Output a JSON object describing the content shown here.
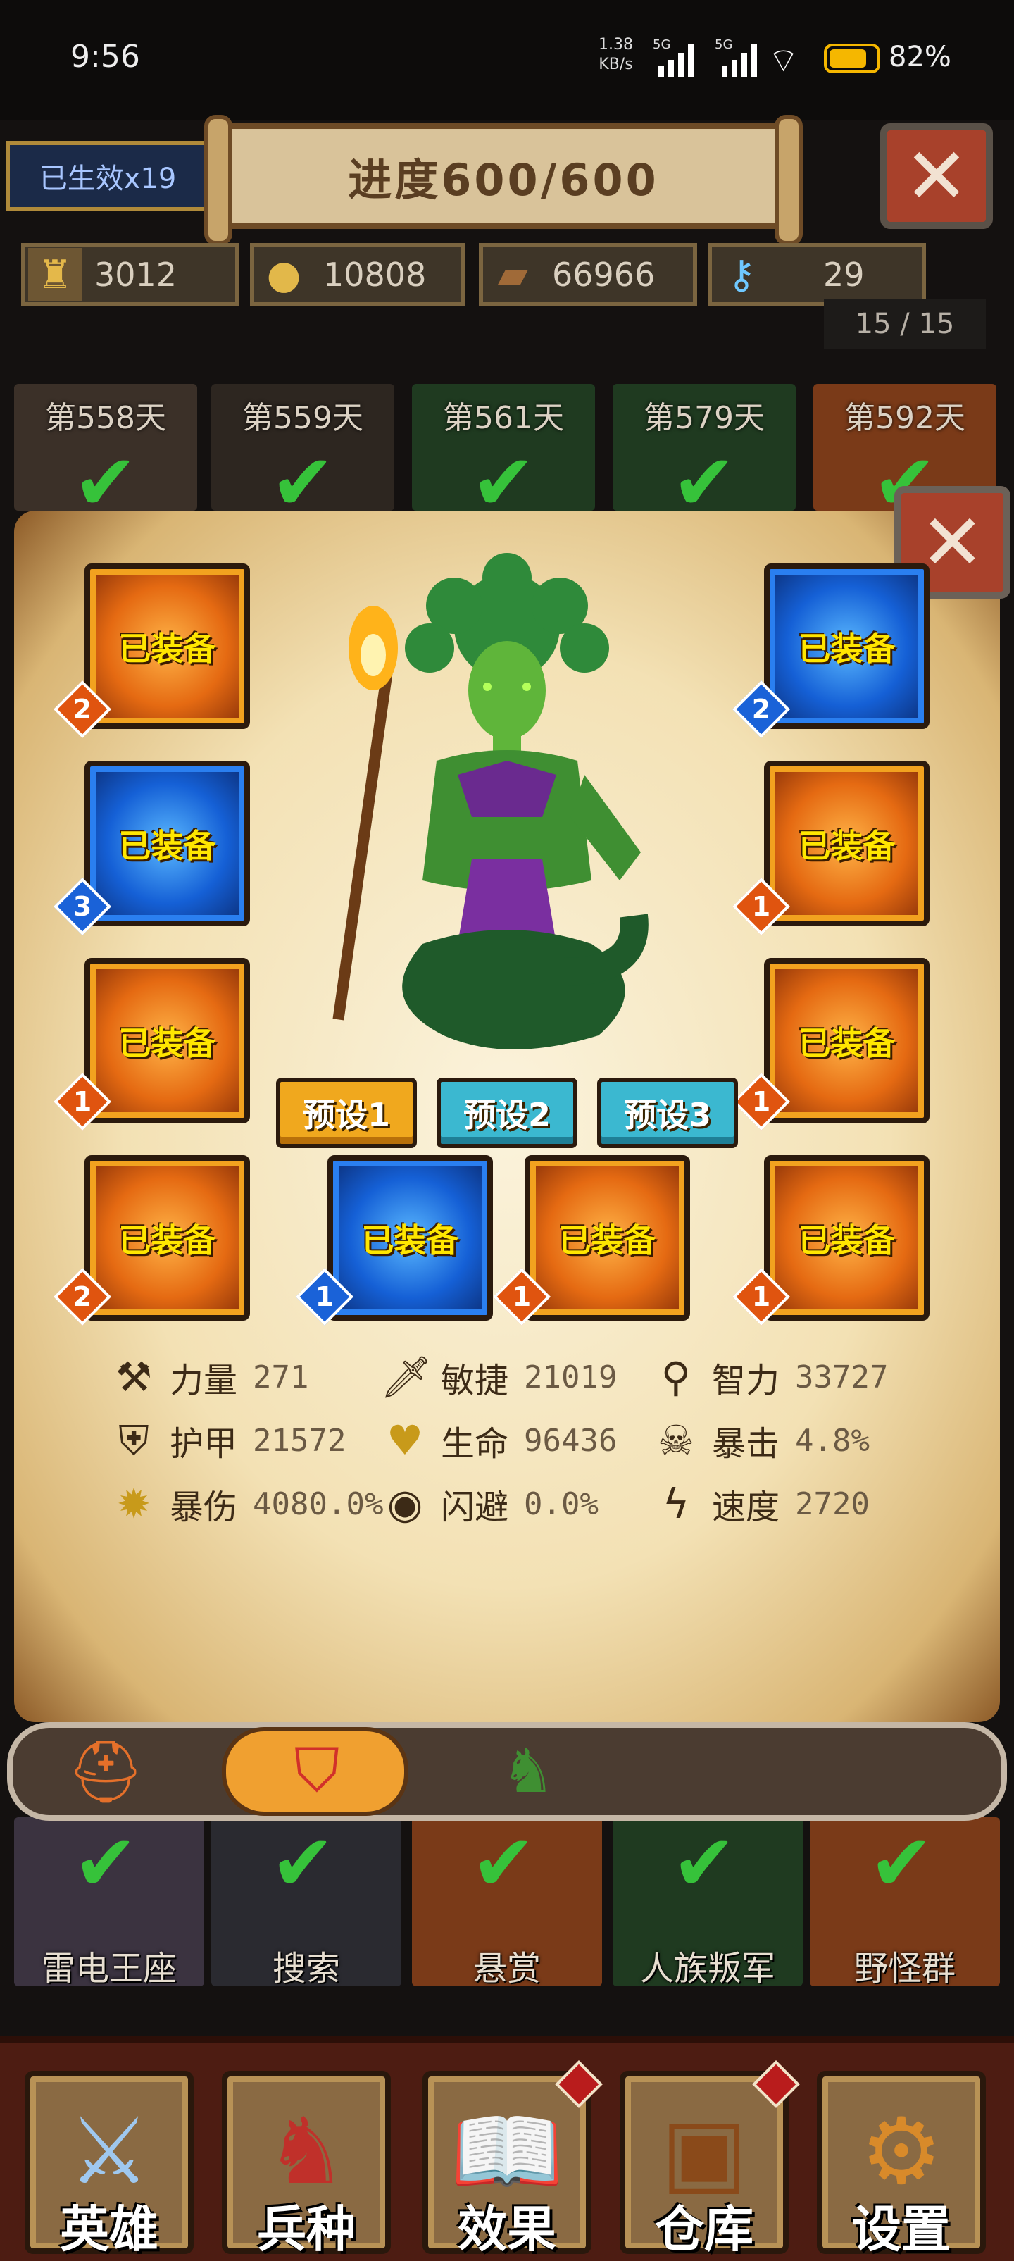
{
  "status_bar": {
    "time": "9:56",
    "net_speed": "1.38",
    "net_unit": "KB/s",
    "sim1": "5G",
    "sim2": "5G",
    "battery": "82%"
  },
  "header": {
    "buff_label": "已生效x19",
    "progress": "进度600/600",
    "close_icon": "close-icon"
  },
  "resources": [
    {
      "icon": "population-icon",
      "value": "3012"
    },
    {
      "icon": "gold-coins-icon",
      "value": "10808"
    },
    {
      "icon": "wood-logs-icon",
      "value": "66966"
    },
    {
      "icon": "crystal-key-icon",
      "value": "29"
    }
  ],
  "page_indicator": "15 / 15",
  "days_top": [
    "第558天",
    "第559天",
    "第561天",
    "第579天",
    "第592天"
  ],
  "equipment": {
    "equipped_label": "已装备",
    "left": [
      {
        "icon": "helmet-icon",
        "level": "2",
        "rarity": "orange"
      },
      {
        "icon": "armor-icon",
        "level": "3",
        "rarity": "blue"
      },
      {
        "icon": "gauntlet-icon",
        "level": "1",
        "rarity": "orange"
      },
      {
        "icon": "bracer-icon",
        "level": "2",
        "rarity": "orange"
      }
    ],
    "right": [
      {
        "icon": "shield-icon",
        "level": "2",
        "rarity": "blue"
      },
      {
        "icon": "boots-icon",
        "level": "1",
        "rarity": "orange"
      },
      {
        "icon": "mount-icon",
        "level": "1",
        "rarity": "orange"
      },
      {
        "icon": "amulet-icon",
        "level": "1",
        "rarity": "orange"
      }
    ],
    "bottom": [
      {
        "icon": "belt-icon",
        "level": "1",
        "rarity": "blue"
      },
      {
        "icon": "ring-icon",
        "level": "1",
        "rarity": "orange"
      }
    ]
  },
  "presets": [
    "预设1",
    "预设2",
    "预设3"
  ],
  "stats": [
    {
      "icon": "axe-icon",
      "name": "力量",
      "value": "271"
    },
    {
      "icon": "sword-icon",
      "name": "敏捷",
      "value": "21019"
    },
    {
      "icon": "staff-icon",
      "name": "智力",
      "value": "33727"
    },
    {
      "icon": "shield-icon",
      "name": "护甲",
      "value": "21572"
    },
    {
      "icon": "heart-icon",
      "name": "生命",
      "value": "96436"
    },
    {
      "icon": "skull-icon",
      "name": "暴击",
      "value": "4.8%"
    },
    {
      "icon": "burst-icon",
      "name": "暴伤",
      "value": "4080.0%"
    },
    {
      "icon": "eye-icon",
      "name": "闪避",
      "value": "0.0%"
    },
    {
      "icon": "lightning-icon",
      "name": "速度",
      "value": "2720"
    }
  ],
  "hero_tabs": [
    "horned-helmet-icon",
    "shield-crest-icon",
    "orc-warrior-icon"
  ],
  "locations": [
    "雷电王座",
    "搜索",
    "悬赏",
    "人族叛军",
    "野怪群"
  ],
  "bottom_nav": [
    {
      "icon": "sword-icon",
      "label": "英雄"
    },
    {
      "icon": "knight-helmet-icon",
      "label": "兵种"
    },
    {
      "icon": "spellbook-icon",
      "label": "效果"
    },
    {
      "icon": "treasure-chest-icon",
      "label": "仓库"
    },
    {
      "icon": "gear-icon",
      "label": "设置"
    }
  ]
}
